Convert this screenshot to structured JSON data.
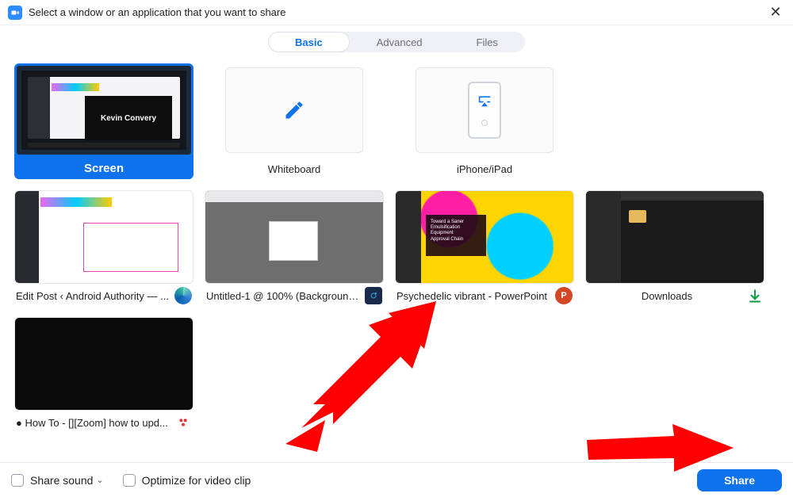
{
  "titlebar": {
    "title": "Select a window or an application that you want to share"
  },
  "tabs": {
    "basic": "Basic",
    "advanced": "Advanced",
    "files": "Files"
  },
  "options": {
    "screen": {
      "label": "Screen",
      "overlay_text": "Kevin Convery"
    },
    "whiteboard": {
      "label": "Whiteboard"
    },
    "iphone": {
      "label": "iPhone/iPad"
    },
    "edit_post": {
      "label": "Edit Post ‹ Android Authority — ..."
    },
    "untitled": {
      "label": "Untitled-1 @ 100% (Background, ..."
    },
    "psychedelic": {
      "label": "Psychedelic vibrant - PowerPoint",
      "slide_text": "Toward a Saner\nEmulsification\nEquipment\nApproval Chain"
    },
    "downloads": {
      "label": "Downloads"
    },
    "howto": {
      "label": "● How To - [][Zoom] how to upd..."
    }
  },
  "bottom": {
    "share_sound": "Share sound",
    "optimize": "Optimize for video clip",
    "share_button": "Share"
  },
  "colors": {
    "accent": "#0e72ed"
  }
}
